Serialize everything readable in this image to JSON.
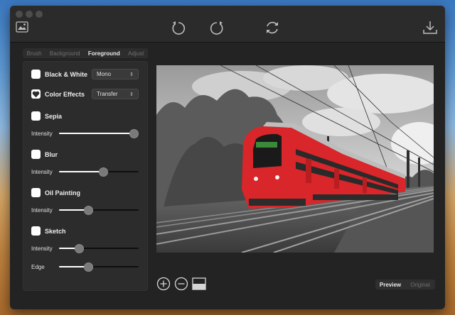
{
  "tabs": [
    {
      "label": "Brush",
      "active": false
    },
    {
      "label": "Background",
      "active": false
    },
    {
      "label": "Foreground",
      "active": true
    },
    {
      "label": "Adjust",
      "active": false
    }
  ],
  "effects": {
    "black_white": {
      "label": "Black & White",
      "checked": false,
      "dropdown": "Mono"
    },
    "color_effects": {
      "label": "Color Effects",
      "checked": true,
      "dropdown": "Transfer"
    },
    "sepia": {
      "label": "Sepia",
      "checked": false,
      "intensity_label": "Intensity",
      "intensity": 1.0
    },
    "blur": {
      "label": "Blur",
      "checked": false,
      "intensity_label": "Intensity",
      "intensity": 0.57
    },
    "oil_painting": {
      "label": "Oil Painting",
      "checked": false,
      "intensity_label": "Intensity",
      "intensity": 0.35
    },
    "sketch": {
      "label": "Sketch",
      "checked": false,
      "intensity_label": "Intensity",
      "intensity": 0.22,
      "edge_label": "Edge",
      "edge": 0.35
    }
  },
  "view_modes": [
    {
      "label": "Preview",
      "active": true
    },
    {
      "label": "Original",
      "active": false
    }
  ],
  "icons": {
    "toolbar": [
      "image-icon",
      "undo-icon",
      "redo-icon",
      "refresh-icon",
      "download-icon"
    ],
    "bottom": [
      "zoom-in-icon",
      "zoom-out-icon",
      "split-view-icon"
    ]
  },
  "colors": {
    "accent": "#ffffff",
    "window_bg": "#232323",
    "panel_bg": "#2c2c2c",
    "train_red": "#d8262a"
  }
}
